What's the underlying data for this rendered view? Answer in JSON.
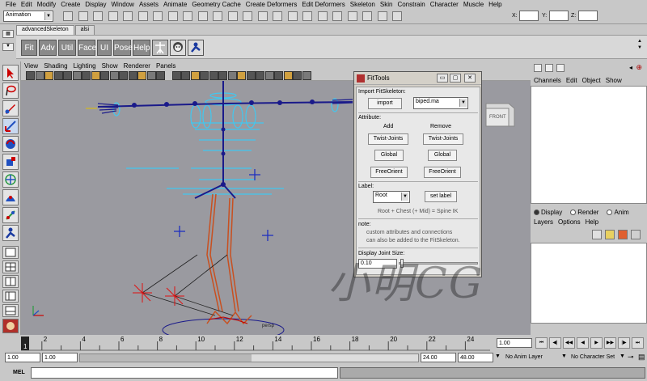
{
  "menubar": [
    "File",
    "Edit",
    "Modify",
    "Create",
    "Display",
    "Window",
    "Assets",
    "Animate",
    "Geometry Cache",
    "Create Deformers",
    "Edit Deformers",
    "Skeleton",
    "Skin",
    "Constrain",
    "Character",
    "Muscle",
    "Help"
  ],
  "statusline": {
    "mode": "Animation",
    "x_label": "X:",
    "y_label": "Y:",
    "z_label": "Z:"
  },
  "shelf": {
    "tabs": [
      "advancedSkeleton",
      "alsi"
    ],
    "buttons": [
      "Fit",
      "Adv",
      "Util",
      "Face",
      "UI",
      "Pose",
      "Help"
    ]
  },
  "panel": {
    "menu": [
      "View",
      "Shading",
      "Lighting",
      "Show",
      "Renderer",
      "Panels"
    ],
    "viewcube": "FRONT",
    "camera_label": "persp"
  },
  "channelbox": {
    "menu": [
      "Channels",
      "Edit",
      "Object",
      "Show"
    ]
  },
  "layers": {
    "radio": [
      "Display",
      "Render",
      "Anim"
    ],
    "menu": [
      "Layers",
      "Options",
      "Help"
    ]
  },
  "fittools": {
    "title": "FitTools",
    "min": "▭",
    "max": "▢",
    "close": "✕",
    "import_section": "Import FitSkeleton:",
    "import_btn": "import",
    "import_file": "biped.ma",
    "attribute_section": "Attribute:",
    "add_header": "Add",
    "remove_header": "Remove",
    "add_buttons": [
      "Twist-Joints",
      "Global",
      "FreeOrient"
    ],
    "remove_buttons": [
      "Twist-Joints",
      "Global",
      "FreeOrient"
    ],
    "label_section": "Label:",
    "label_value": "Root",
    "set_label_btn": "set label",
    "label_hint": "Root + Chest (+ Mid) = Spine IK",
    "note_section": "note:",
    "note_line1": "custom attributes and connections",
    "note_line2": "can also be added to the FitSkeleton.",
    "joint_size_section": "Display Joint Size:",
    "joint_size_value": "0.10"
  },
  "timeline": {
    "ticks": [
      "1",
      "2",
      "4",
      "6",
      "8",
      "10",
      "12",
      "14",
      "16",
      "18",
      "20",
      "22",
      "24"
    ],
    "current_frame": "1.00"
  },
  "range": {
    "start": "1.00",
    "playback_start": "1.00",
    "playback_end": "24.00",
    "end": "48.00",
    "anim_layer": "No Anim Layer",
    "character_set": "No Character Set"
  },
  "mel": {
    "label": "MEL"
  },
  "watermark": "小明CG",
  "colors": {
    "viewport_bg": "#9a9aa0",
    "joint_blue": "#1a1a8a",
    "control_cyan": "#40c8f0",
    "bone_orange": "#c85020",
    "ik_red": "#e01010"
  }
}
